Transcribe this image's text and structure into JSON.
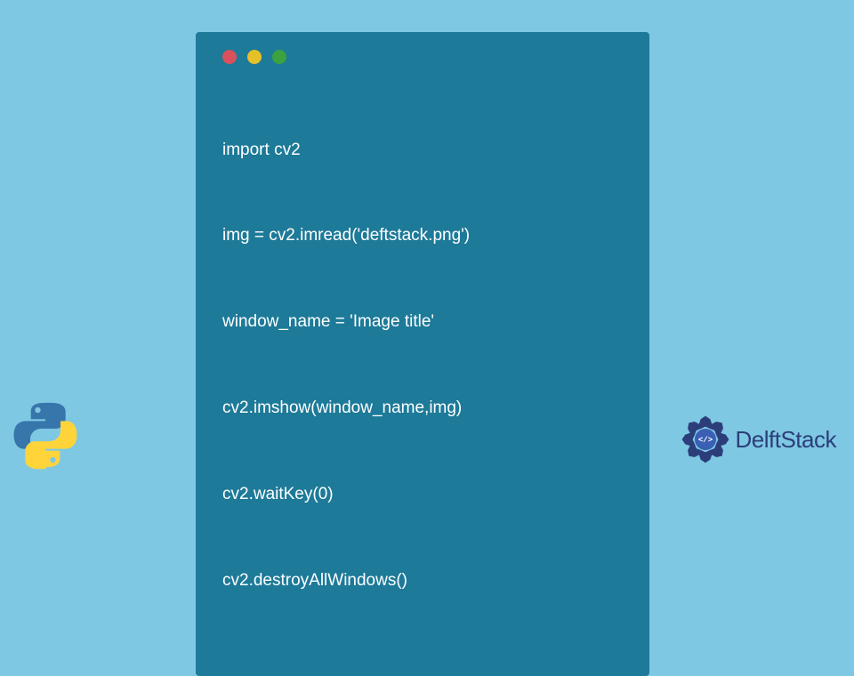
{
  "code_lines": [
    "import cv2",
    "img = cv2.imread('deftstack.png')",
    "window_name = 'Image title'",
    "cv2.imshow(window_name,img)",
    "cv2.waitKey(0)",
    "cv2.destroyAllWindows()"
  ],
  "brand": {
    "name": "DelftStack"
  }
}
